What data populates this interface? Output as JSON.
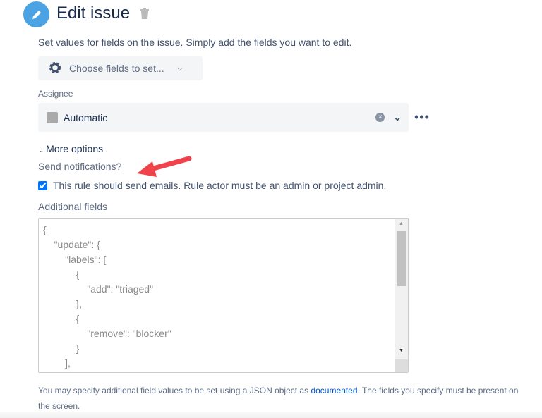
{
  "header": {
    "title": "Edit issue",
    "description": "Set values for fields on the issue. Simply add the fields you want to edit."
  },
  "choose_fields": {
    "label": "Choose fields to set..."
  },
  "assignee": {
    "label": "Assignee",
    "value": "Automatic"
  },
  "more_options": {
    "label": "More options",
    "send_label": "Send notifications?",
    "checkbox_label": "This rule should send emails. Rule actor must be an admin or project admin.",
    "checked": true
  },
  "additional": {
    "label": "Additional fields",
    "lines": [
      "{",
      "    \"update\": {",
      "        \"labels\": [",
      "            {",
      "                \"add\": \"triaged\"",
      "            },",
      "            {",
      "                \"remove\": \"blocker\"",
      "            }",
      "        ],"
    ]
  },
  "footer": {
    "pre": "You may specify additional field values to be set using a JSON object as ",
    "link": "documented",
    "post": ". The fields you specify must be present on the screen."
  },
  "colors": {
    "accent": "#4ba3e3",
    "link": "#0052cc",
    "arrow": "#f0424b"
  }
}
